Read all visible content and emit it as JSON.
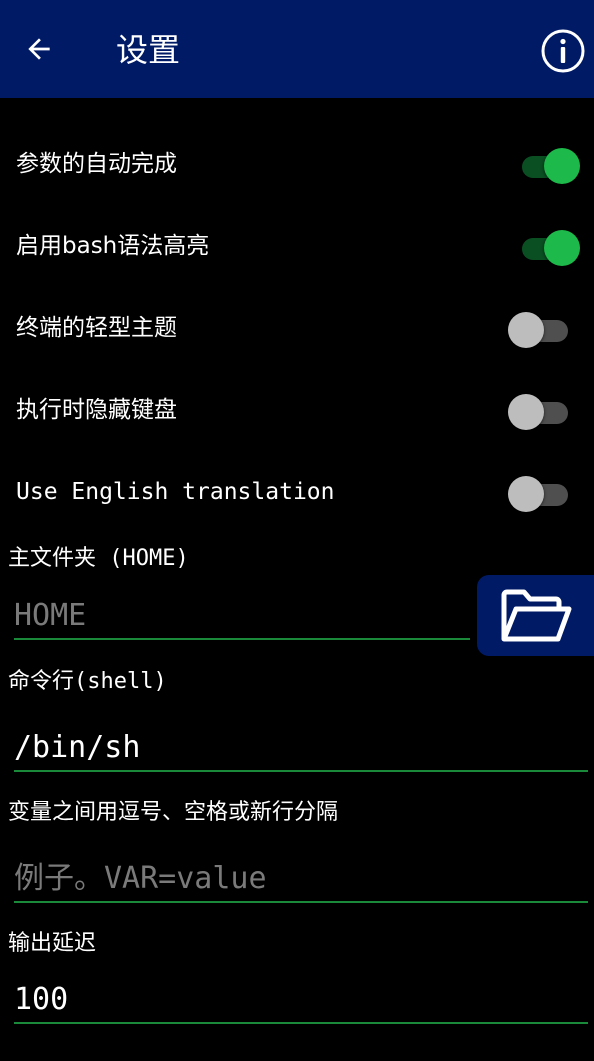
{
  "appbar": {
    "title": "设置",
    "back_icon": "arrow-left-icon",
    "info_icon": "info-circle-icon",
    "background": "#001a66"
  },
  "toggles": [
    {
      "label": "参数的自动完成",
      "on": true
    },
    {
      "label": "启用bash语法高亮",
      "on": true
    },
    {
      "label": "终端的轻型主题",
      "on": false
    },
    {
      "label": "执行时隐藏键盘",
      "on": false
    },
    {
      "label": "Use English translation",
      "on": false
    }
  ],
  "home_field": {
    "label": "主文件夹 (HOME)",
    "value": "",
    "placeholder": "HOME",
    "button_icon": "folder-open-icon"
  },
  "shell_field": {
    "label": "命令行(shell)",
    "value": "/bin/sh",
    "placeholder": ""
  },
  "env_field": {
    "label": "变量之间用逗号、空格或新行分隔",
    "value": "",
    "placeholder": "例子。VAR=value"
  },
  "delay_field": {
    "label": "输出延迟",
    "value": "100",
    "placeholder": ""
  },
  "colors": {
    "accent_green": "#1db94a",
    "underline_green": "#1a8a3a",
    "appbar_blue": "#001a66"
  }
}
